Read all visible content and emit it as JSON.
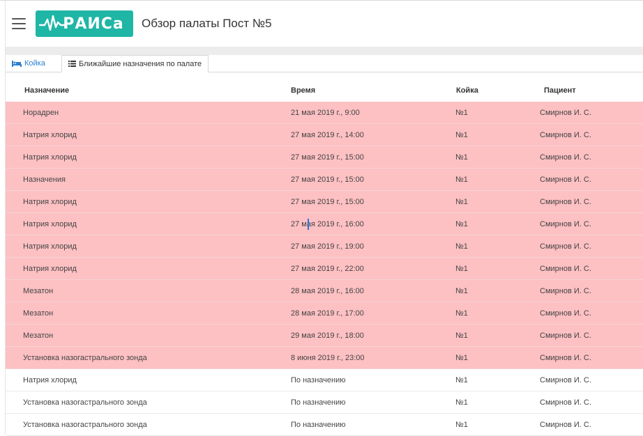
{
  "header": {
    "logo_text": "РАИСа",
    "title": "Обзор палаты Пост №5"
  },
  "tabs": [
    {
      "label": "Койка",
      "icon": "bed-icon",
      "active": false
    },
    {
      "label": "Ближайшие назначения по палате",
      "icon": "list-icon",
      "active": true
    }
  ],
  "table": {
    "columns": [
      "Назначение",
      "Время",
      "Койка",
      "Пациент"
    ],
    "rows": [
      {
        "name": "Норадрен",
        "time": "21 мая 2019 г., 9:00",
        "bed": "№1",
        "patient": "Смирнов И. С.",
        "overdue": true
      },
      {
        "name": "Натрия хлорид",
        "time": "27 мая 2019 г., 14:00",
        "bed": "№1",
        "patient": "Смирнов И. С.",
        "overdue": true
      },
      {
        "name": "Натрия хлорид",
        "time": "27 мая 2019 г., 15:00",
        "bed": "№1",
        "patient": "Смирнов И. С.",
        "overdue": true
      },
      {
        "name": "Назначения",
        "time": "27 мая 2019 г., 15:00",
        "bed": "№1",
        "patient": "Смирнов И. С.",
        "overdue": true
      },
      {
        "name": "Натрия хлорид",
        "time": "27 мая 2019 г., 15:00",
        "bed": "№1",
        "patient": "Смирнов И. С.",
        "overdue": true
      },
      {
        "name": "Натрия хлорид",
        "time": "27 мая 2019 г., 16:00",
        "bed": "№1",
        "patient": "Смирнов И. С.",
        "overdue": true
      },
      {
        "name": "Натрия хлорид",
        "time": "27 мая 2019 г., 19:00",
        "bed": "№1",
        "patient": "Смирнов И. С.",
        "overdue": true
      },
      {
        "name": "Натрия хлорид",
        "time": "27 мая 2019 г., 22:00",
        "bed": "№1",
        "patient": "Смирнов И. С.",
        "overdue": true
      },
      {
        "name": "Мезатон",
        "time": "28 мая 2019 г., 16:00",
        "bed": "№1",
        "patient": "Смирнов И. С.",
        "overdue": true
      },
      {
        "name": "Мезатон",
        "time": "28 мая 2019 г., 17:00",
        "bed": "№1",
        "patient": "Смирнов И. С.",
        "overdue": true
      },
      {
        "name": "Мезатон",
        "time": "29 мая 2019 г., 18:00",
        "bed": "№1",
        "patient": "Смирнов И. С.",
        "overdue": true
      },
      {
        "name": "Установка назогастрального зонда",
        "time": "8 июня 2019 г., 23:00",
        "bed": "№1",
        "patient": "Смирнов И. С.",
        "overdue": true
      },
      {
        "name": "Натрия хлорид",
        "time": "По назначению",
        "bed": "№1",
        "patient": "Смирнов И. С.",
        "overdue": false
      },
      {
        "name": "Установка назогастрального зонда",
        "time": "По назначению",
        "bed": "№1",
        "patient": "Смирнов И. С.",
        "overdue": false
      },
      {
        "name": "Установка назогастрального зонда",
        "time": "По назначению",
        "bed": "№1",
        "patient": "Смирнов И. С.",
        "overdue": false
      }
    ]
  },
  "colors": {
    "brand": "#1fb6a6",
    "overdue_row": "#fdc0c3",
    "tab_link": "#2a7fd0"
  }
}
